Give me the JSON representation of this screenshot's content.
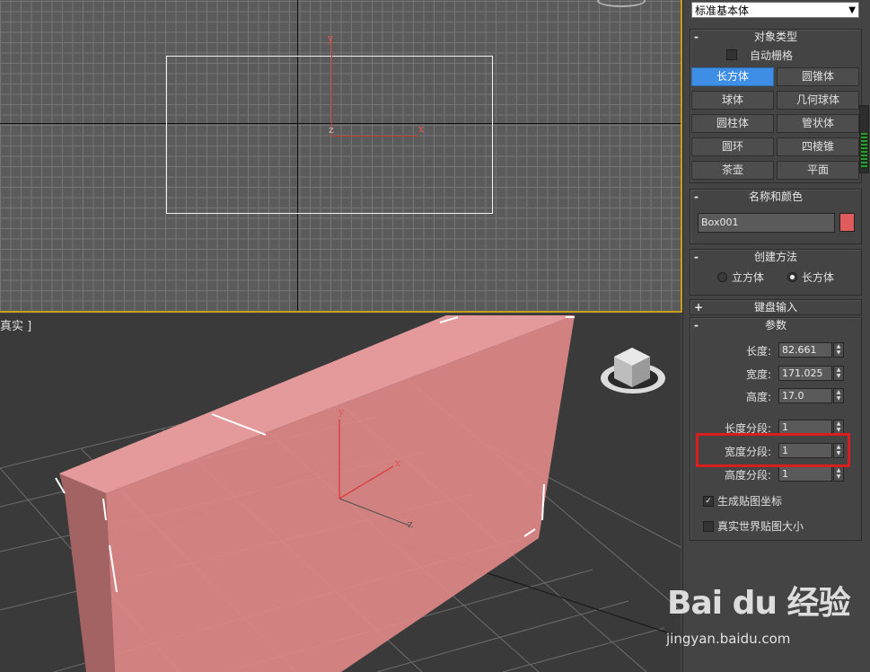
{
  "viewports": {
    "top": {
      "gizmo": {
        "y": "y",
        "x": "x",
        "z": "z"
      }
    },
    "perspective": {
      "label": "真实 ]",
      "gizmo": {
        "y": "y",
        "x": "x",
        "z": "z"
      },
      "object_color": "#e08888"
    }
  },
  "panel": {
    "category": {
      "value": "标准基本体"
    },
    "object_type": {
      "title": "对象类型",
      "toggle": "-",
      "autogrid": {
        "label": "自动栅格",
        "checked": false
      },
      "buttons": [
        {
          "label": "长方体",
          "active": true
        },
        {
          "label": "圆锥体"
        },
        {
          "label": "球体"
        },
        {
          "label": "几何球体"
        },
        {
          "label": "圆柱体"
        },
        {
          "label": "管状体"
        },
        {
          "label": "圆环"
        },
        {
          "label": "四棱锥"
        },
        {
          "label": "茶壶"
        },
        {
          "label": "平面"
        }
      ]
    },
    "name_color": {
      "title": "名称和颜色",
      "toggle": "-",
      "name_value": "Box001",
      "color": "#e05c5c"
    },
    "creation_method": {
      "title": "创建方法",
      "toggle": "-",
      "options": [
        {
          "label": "立方体",
          "selected": false
        },
        {
          "label": "长方体",
          "selected": true
        }
      ]
    },
    "keyboard_entry": {
      "title": "键盘输入",
      "toggle": "+"
    },
    "parameters": {
      "title": "参数",
      "toggle": "-",
      "length": {
        "label": "长度:",
        "value": "82.661"
      },
      "width": {
        "label": "宽度:",
        "value": "171.025"
      },
      "height": {
        "label": "高度:",
        "value": "17.0"
      },
      "length_segs": {
        "label": "长度分段:",
        "value": "1"
      },
      "width_segs": {
        "label": "宽度分段:",
        "value": "1"
      },
      "height_segs": {
        "label": "高度分段:",
        "value": "1"
      },
      "gen_mapping": {
        "label": "生成贴图坐标",
        "checked": true
      },
      "real_world": {
        "label": "真实世界贴图大小",
        "checked": false
      }
    }
  },
  "watermark": {
    "brand": "Bai du 经验",
    "url": "jingyan.baidu.com"
  }
}
